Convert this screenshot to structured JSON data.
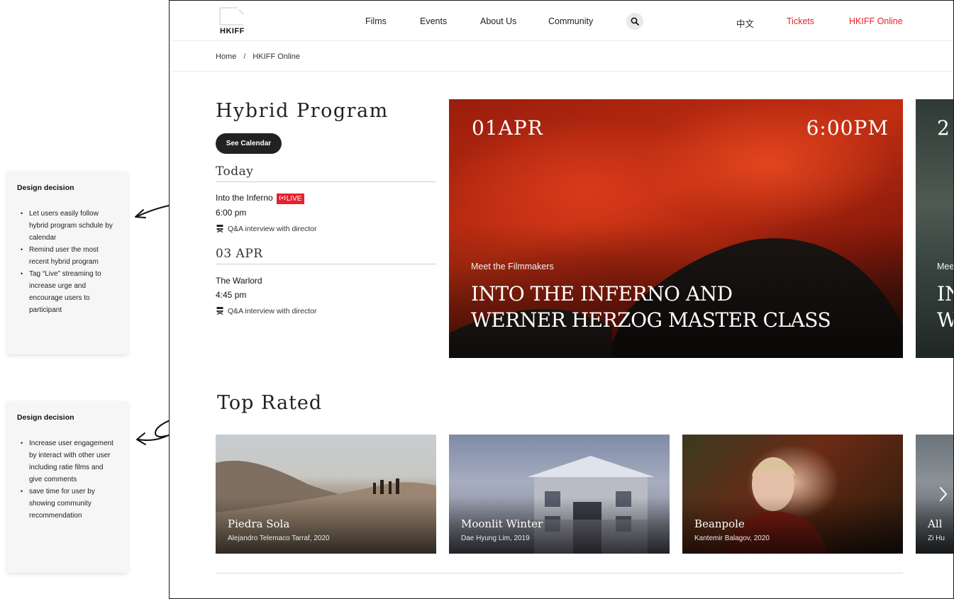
{
  "notes": [
    {
      "title": "Design decision",
      "items": [
        "Let users easily follow hybrid program schdule by calendar",
        "Remind user the most recent hybrid program",
        "Tag “Live” streaming to increase urge and encourage users to participant"
      ]
    },
    {
      "title": "Design decision",
      "items": [
        "Increase user engagement by interact with other user including ratie films and give comments",
        "save time for user by showing community recommendation"
      ]
    }
  ],
  "header": {
    "logo_text": "HKIFF",
    "nav": [
      "Films",
      "Events",
      "About Us",
      "Community"
    ],
    "language": "中文",
    "tickets": "Tickets",
    "online": "HKIFF Online",
    "icons": {
      "search": "search-icon",
      "logo": "hkiff-logo-icon"
    }
  },
  "breadcrumb": {
    "home": "Home",
    "separator": "/",
    "current": "HKIFF Online"
  },
  "hybrid": {
    "title": "Hybrid Program",
    "calendar_button": "See Calendar",
    "days": [
      {
        "label": "Today",
        "events": [
          {
            "title": "Into the Inferno",
            "live": "LIVE",
            "time": "6:00 pm",
            "meta": "Q&A interview with director"
          }
        ]
      },
      {
        "label": "03 APR",
        "events": [
          {
            "title": "The Warlord",
            "live": "",
            "time": "4:45 pm",
            "meta": "Q&A interview with director"
          }
        ]
      }
    ]
  },
  "hero": {
    "date": "01APR",
    "time": "6:00PM",
    "kicker": "Meet the Filmmakers",
    "title_line1": "INTO THE INFERNO AND",
    "title_line2": "WERNER HERZOG MASTER CLASS"
  },
  "hero_peek": {
    "date": "2",
    "kicker": "Mee",
    "title_line1": "IN",
    "title_line2": "W"
  },
  "top_rated": {
    "title": "Top Rated",
    "cards": [
      {
        "title": "Piedra Sola",
        "subtitle": "Alejandro Telemaco Tarraf, 2020"
      },
      {
        "title": "Moonlit Winter",
        "subtitle": "Dae Hyung Lim, 2019"
      },
      {
        "title": "Beanpole",
        "subtitle": "Kantemir Balagov, 2020"
      },
      {
        "title": "All",
        "subtitle": "Zi Hu"
      }
    ]
  },
  "colors": {
    "accent": "#e6222b",
    "dark": "#222222"
  }
}
